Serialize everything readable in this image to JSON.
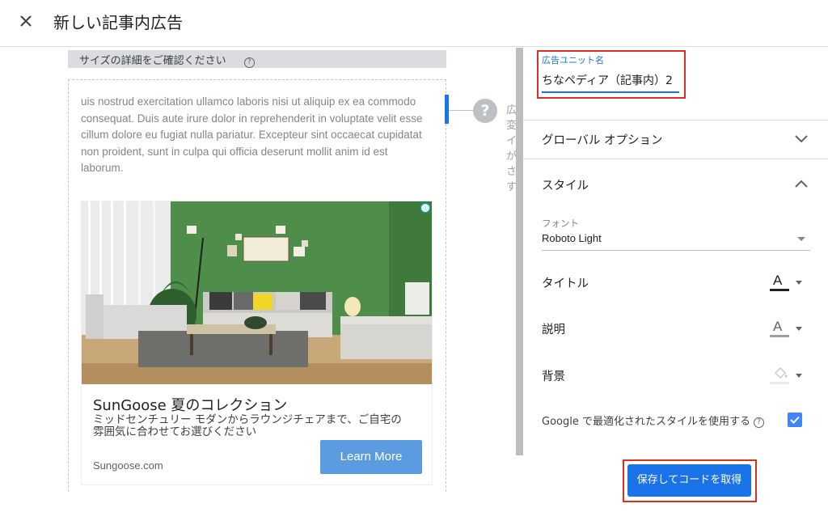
{
  "header": {
    "title": "新しい記事内広告",
    "close_icon": "close-icon"
  },
  "preview": {
    "size_bar_text": "サイズの詳細をご確認ください",
    "lorem_text": "uis nostrud exercitation ullamco laboris nisi ut aliquip ex ea commodo consequat. Duis aute irure dolor in reprehenderit in voluptate velit esse cillum dolore eu fugiat nulla pariatur. Excepteur sint occaecat cupidatat non proident, sunt in culpa qui officia deserunt mollit anim id est laborum.",
    "tip_text": [
      "広",
      "変",
      "イ",
      "が",
      "さ",
      "す"
    ],
    "ad": {
      "title": "SunGoose 夏のコレクション",
      "description": "ミッドセンチュリー モダンからラウンジチェアまで、ご自宅の雰囲気に合わせてお選びください",
      "domain": "Sungoose.com",
      "cta": "Learn More",
      "info_icon": "ⓘ"
    }
  },
  "panel": {
    "ad_unit": {
      "label": "広告ユニット名",
      "value": "ちなペディア（記事内）2"
    },
    "global_options": "グローバル オプション",
    "style": {
      "heading": "スタイル",
      "font_label": "フォント",
      "font_value": "Roboto Light",
      "title_label": "タイトル",
      "description_label": "説明",
      "background_label": "背景",
      "title_color": "#202124",
      "description_color": "#9e9e9e",
      "background_color": "#e8eaed",
      "google_optimized_label": "Google で最適化されたスタイルを使用する",
      "google_optimized_checked": true
    },
    "save_button": "保存してコードを取得"
  },
  "colors": {
    "accent": "#1a73e8",
    "highlight": "#d93025"
  }
}
